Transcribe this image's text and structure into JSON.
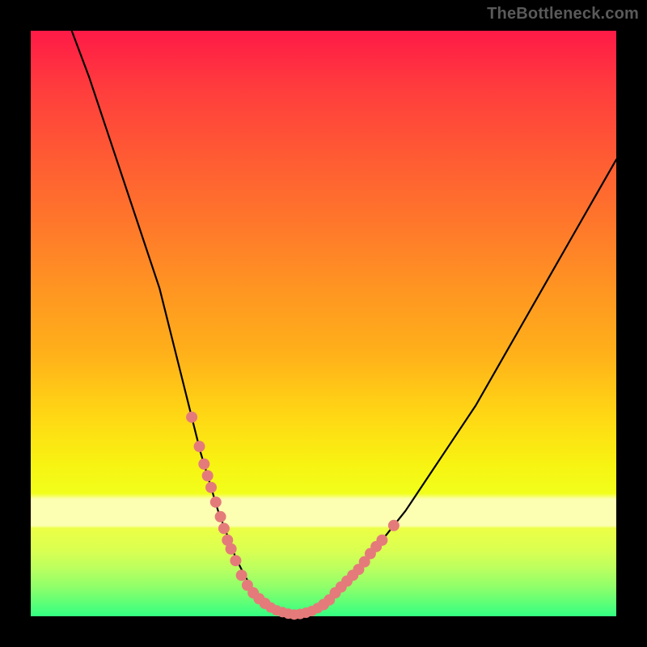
{
  "watermark": {
    "text": "TheBottleneck.com"
  },
  "chart_data": {
    "type": "line",
    "title": "",
    "xlabel": "",
    "ylabel": "",
    "xlim": [
      0,
      100
    ],
    "ylim": [
      0,
      100
    ],
    "grid": false,
    "legend": false,
    "series": [
      {
        "name": "curve",
        "x": [
          7,
          10,
          13,
          16,
          19,
          22,
          24,
          26,
          27.5,
          29,
          30.5,
          32,
          33.5,
          35,
          36.5,
          38,
          40,
          42,
          45,
          48,
          52,
          56,
          60,
          64,
          68,
          72,
          76,
          80,
          84,
          88,
          92,
          96,
          100
        ],
        "y": [
          100,
          92,
          83,
          74,
          65,
          56,
          48,
          40,
          34,
          28,
          23,
          18,
          14,
          10,
          7,
          4.5,
          2.2,
          1,
          0.3,
          1.2,
          4,
          8,
          13,
          18,
          24,
          30,
          36,
          43,
          50,
          57,
          64,
          71,
          78
        ]
      },
      {
        "name": "markers-left",
        "x": [
          27.5,
          28.8,
          29.6,
          30.2,
          30.8,
          31.6,
          32.4,
          33,
          33.6,
          34.2,
          35,
          36,
          37,
          38,
          39,
          40
        ],
        "y": [
          34,
          29,
          26,
          24,
          22,
          19.5,
          17,
          15,
          13,
          11.5,
          9.5,
          7,
          5.3,
          4,
          3,
          2.2
        ]
      },
      {
        "name": "markers-bottom",
        "x": [
          40,
          41,
          42,
          43,
          44,
          45,
          46,
          47,
          48,
          49,
          50
        ],
        "y": [
          2.2,
          1.5,
          1.0,
          0.7,
          0.45,
          0.3,
          0.4,
          0.6,
          0.9,
          1.4,
          2.0
        ]
      },
      {
        "name": "markers-right",
        "x": [
          50,
          51,
          52,
          53,
          54,
          55,
          56,
          57,
          58,
          59,
          60,
          62
        ],
        "y": [
          2.0,
          2.8,
          4.0,
          5.0,
          6.0,
          7.0,
          8.0,
          9.3,
          10.7,
          11.9,
          13,
          15.5
        ]
      }
    ],
    "annotations": [
      {
        "text": "TheBottleneck.com",
        "position": "top-right"
      }
    ]
  }
}
